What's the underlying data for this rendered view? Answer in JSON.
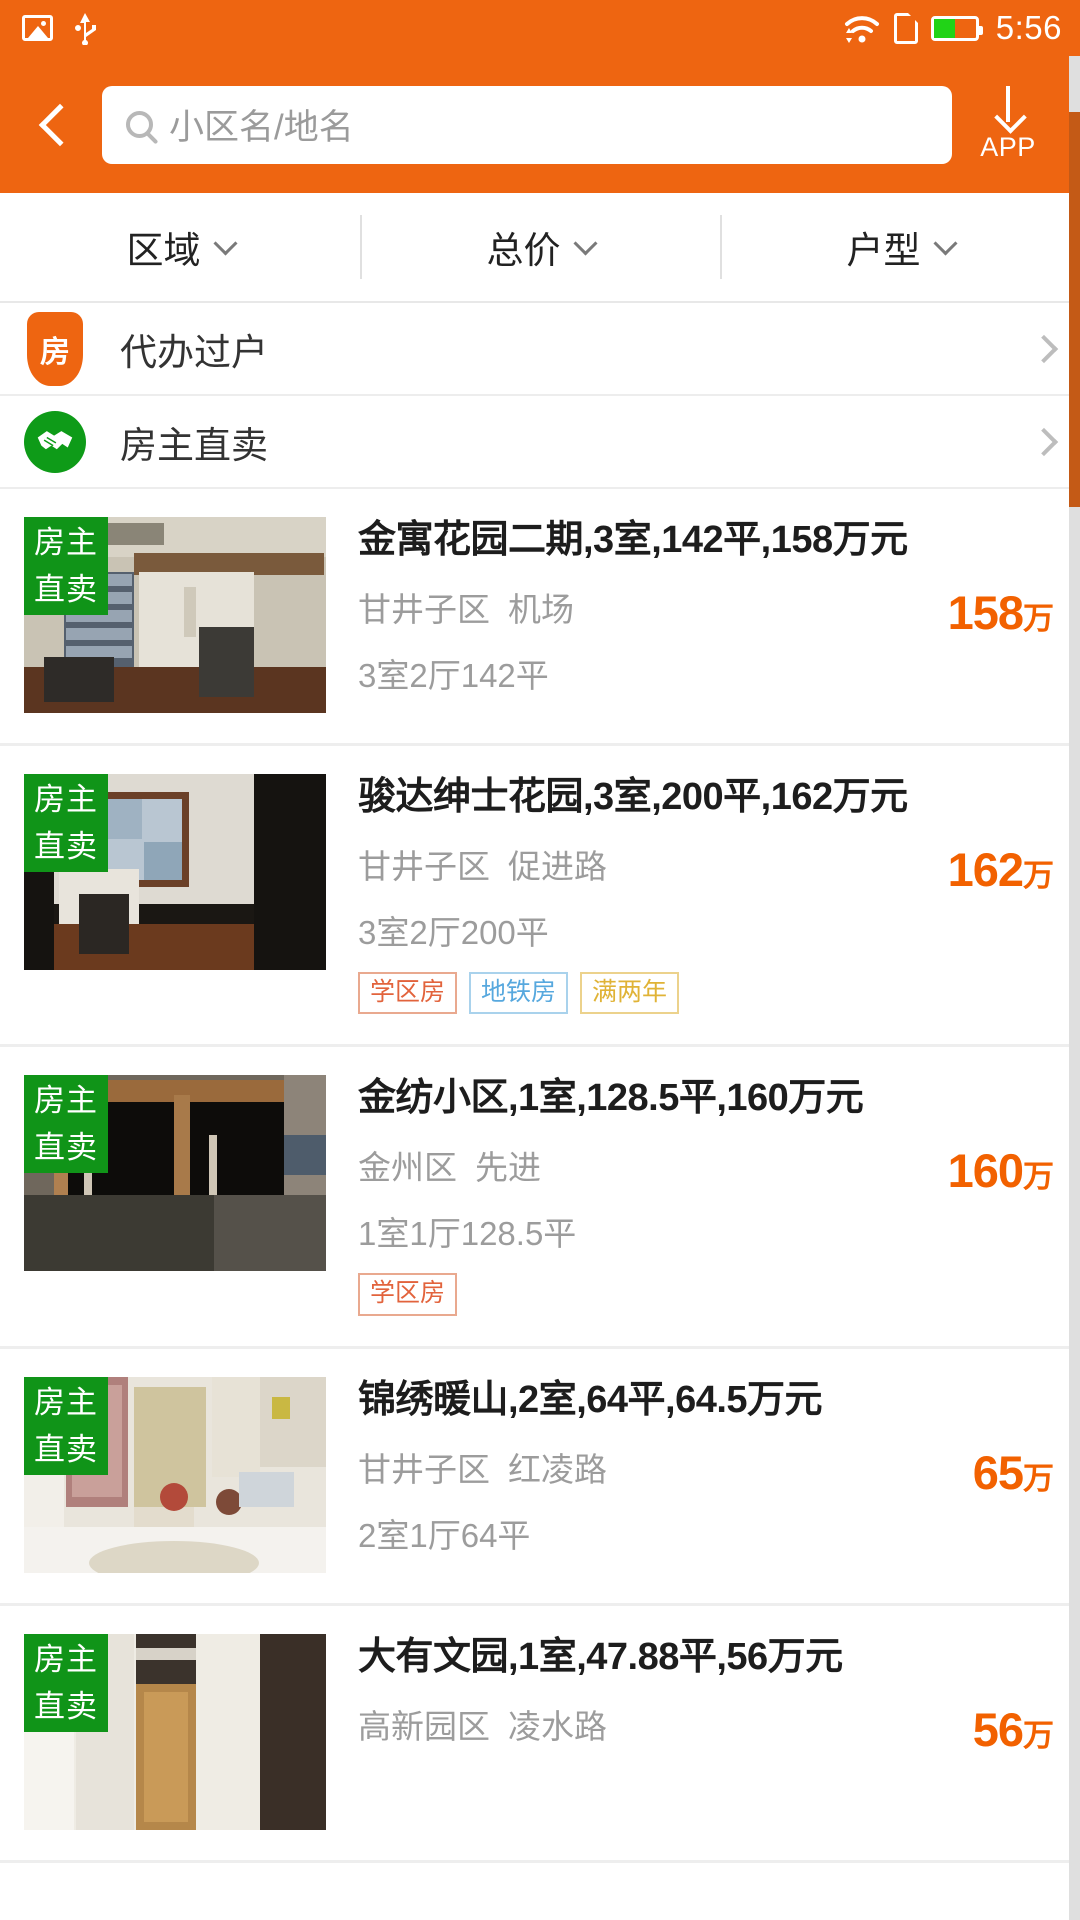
{
  "statusbar": {
    "time": "5:56",
    "icons": [
      "screenshot-icon",
      "usb-icon",
      "wifi-icon",
      "sim-card-icon",
      "battery-icon"
    ],
    "battery_percent": 50
  },
  "header": {
    "back_label": "",
    "search_placeholder": "小区名/地名",
    "search_value": "",
    "app_button_label": "APP",
    "accent_color": "#EE6511"
  },
  "filters": [
    {
      "label": "区域"
    },
    {
      "label": "总价"
    },
    {
      "label": "户型"
    }
  ],
  "banners": [
    {
      "label": "代办过户",
      "icon": "shield-house-icon",
      "icon_text": "房",
      "color": "#EE6511"
    },
    {
      "label": "房主直卖",
      "icon": "handshake-icon",
      "icon_text": "",
      "color": "#0E9B18"
    }
  ],
  "listings": [
    {
      "badge_line1": "房主",
      "badge_line2": "直卖",
      "title": "金寓花园二期,3室,142平,158万元",
      "district": "甘井子区",
      "area_name": "机场",
      "spec": "3室2厅",
      "size": "142平",
      "price_num": "158",
      "price_unit": "万",
      "tags": []
    },
    {
      "badge_line1": "房主",
      "badge_line2": "直卖",
      "title": "骏达绅士花园,3室,200平,162万元",
      "district": "甘井子区",
      "area_name": "促进路",
      "spec": "3室2厅",
      "size": "200平",
      "price_num": "162",
      "price_unit": "万",
      "tags": [
        {
          "label": "学区房",
          "kind": "school"
        },
        {
          "label": "地铁房",
          "kind": "metro"
        },
        {
          "label": "满两年",
          "kind": "twoyear"
        }
      ]
    },
    {
      "badge_line1": "房主",
      "badge_line2": "直卖",
      "title": "金纺小区,1室,128.5平,160万元",
      "district": "金州区",
      "area_name": "先进",
      "spec": "1室1厅",
      "size": "128.5平",
      "price_num": "160",
      "price_unit": "万",
      "tags": [
        {
          "label": "学区房",
          "kind": "school"
        }
      ]
    },
    {
      "badge_line1": "房主",
      "badge_line2": "直卖",
      "title": "锦绣暖山,2室,64平,64.5万元",
      "district": "甘井子区",
      "area_name": "红凌路",
      "spec": "2室1厅",
      "size": "64平",
      "price_num": "65",
      "price_unit": "万",
      "tags": []
    },
    {
      "badge_line1": "房主",
      "badge_line2": "直卖",
      "title": "大有文园,1室,47.88平,56万元",
      "district": "高新园区",
      "area_name": "凌水路",
      "spec": "",
      "size": "",
      "price_num": "56",
      "price_unit": "万",
      "tags": []
    }
  ],
  "colors": {
    "accent_orange": "#EE6511",
    "price_orange": "#F26100",
    "badge_green": "#109418",
    "banner_green": "#0E9B18"
  }
}
